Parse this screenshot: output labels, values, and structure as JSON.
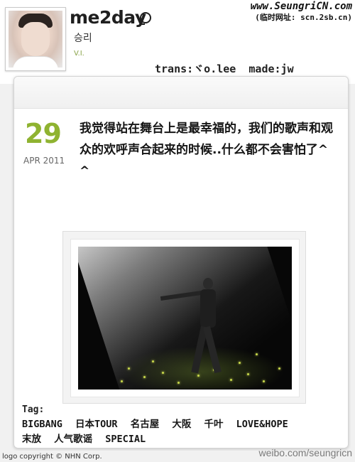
{
  "header": {
    "brand": "me2day",
    "username": "승리",
    "user_tag": "V.I.",
    "watermark_line1": "www.SeungriCN.com",
    "watermark_line2": "(临时网址: scn.2sb.cn)",
    "credits": "trans:ヾo.lee  made:jw"
  },
  "post": {
    "day": "29",
    "month_year": "APR 2011",
    "text": "我觉得站在舞台上是最幸福的，我们的歌声和观众的欢呼声合起来的时候..什么都不会害怕了^ ^"
  },
  "tags": {
    "label": "Tag:",
    "items": [
      "BIGBANG",
      "日本TOUR",
      "名古屋",
      "大阪",
      "千叶",
      "LOVE&HOPE",
      "末放",
      "人气歌谣",
      "SPECIAL"
    ]
  },
  "footer": {
    "copyright": "logo copyright © NHN Corp.",
    "weibo": "weibo.com/seungricn"
  },
  "colors": {
    "date_green": "#8fb331",
    "tag_green": "#8aa34a"
  }
}
